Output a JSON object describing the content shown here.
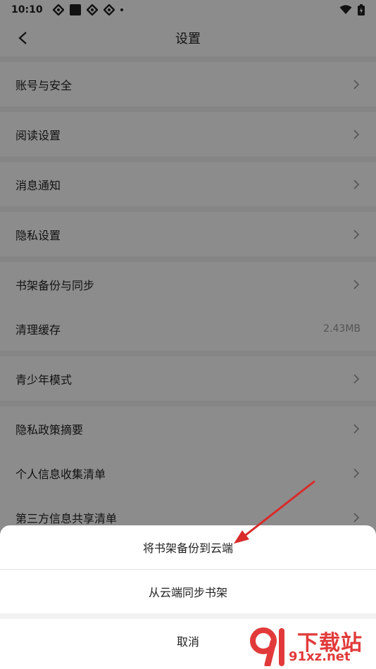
{
  "status_bar": {
    "time": "10:10"
  },
  "header": {
    "title": "设置"
  },
  "settings": {
    "account_security": "账号与安全",
    "reading_settings": "阅读设置",
    "notifications": "消息通知",
    "privacy_settings": "隐私设置",
    "bookshelf_backup": "书架备份与同步",
    "clear_cache": "清理缓存",
    "cache_size": "2.43MB",
    "youth_mode": "青少年模式",
    "privacy_summary": "隐私政策摘要",
    "personal_info_list": "个人信息收集清单",
    "third_party_list": "第三方信息共享清单"
  },
  "sheet": {
    "backup_to_cloud": "将书架备份到云端",
    "sync_from_cloud": "从云端同步书架",
    "cancel": "取消"
  },
  "watermark": {
    "title": "下载站",
    "url": "91xz.net"
  },
  "colors": {
    "overlay": "#000000",
    "arrow": "#d92b2b",
    "watermark": "#e23a3a"
  }
}
